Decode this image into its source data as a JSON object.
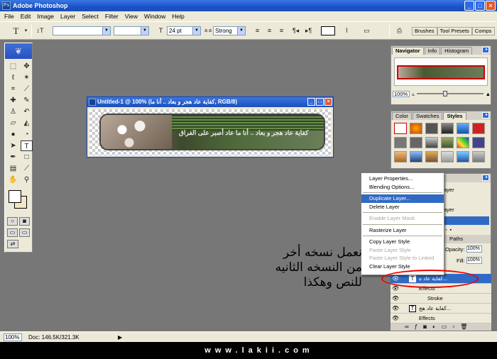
{
  "window": {
    "title": "Adobe Photoshop",
    "min": "_",
    "max": "□",
    "close": "×"
  },
  "menu": [
    "File",
    "Edit",
    "Image",
    "Layer",
    "Select",
    "Filter",
    "View",
    "Window",
    "Help"
  ],
  "options": {
    "font_size": "24 pt",
    "aa_label": "a a",
    "antialias": "Strong",
    "tabs": [
      "Brushes",
      "Tool Presets",
      "Comps"
    ]
  },
  "document": {
    "title": "Untitled-1 @ 100% (كفاية عاد هجر و بعاد .. أنا ما, RGB/8)",
    "banner_text": "كفاية عاد هجر و بعاد .. أنا ما عاد أصبر على الفراق"
  },
  "navigator": {
    "tabs": [
      "Navigator",
      "Info",
      "Histogram"
    ],
    "zoom": "100%"
  },
  "styles": {
    "tabs": [
      "Color",
      "Swatches",
      "Styles"
    ]
  },
  "layers": {
    "tabs": [
      "Paths"
    ],
    "opacity_label": "Opacity:",
    "opacity": "100%",
    "fill_label": "Fill:",
    "fill": "100%",
    "peek_1": "ayer",
    "peek_2": "ayer",
    "rows": [
      {
        "name": "كفاية عاد ه...",
        "selected": true
      },
      {
        "name": "Effects",
        "selected": false
      },
      {
        "name": "Stroke",
        "selected": false
      },
      {
        "name": "كفاية عاد هج...",
        "selected": false
      },
      {
        "name": "Effects",
        "selected": false
      }
    ]
  },
  "context_menu": {
    "items": [
      {
        "label": "Layer Properties...",
        "state": "normal"
      },
      {
        "label": "Blending Options...",
        "state": "normal"
      },
      {
        "sep": true
      },
      {
        "label": "Duplicate Layer...",
        "state": "highlighted"
      },
      {
        "label": "Delete Layer",
        "state": "normal"
      },
      {
        "sep": true
      },
      {
        "label": "Enable Layer Mask",
        "state": "disabled"
      },
      {
        "sep": true
      },
      {
        "label": "Rasterize Layer",
        "state": "normal"
      },
      {
        "sep": true
      },
      {
        "label": "Copy Layer Style",
        "state": "normal"
      },
      {
        "label": "Paste Layer Style",
        "state": "disabled"
      },
      {
        "label": "Paste Layer Style to Linked",
        "state": "disabled"
      },
      {
        "label": "Clear Layer Style",
        "state": "normal"
      }
    ]
  },
  "annotation": {
    "line1": "نعمل نسخه أخر",
    "line2": "من النسخه الثانيه",
    "line3": "للنص وهكذا"
  },
  "status": {
    "zoom": "100%",
    "doc": "Doc: 146.5K/321.3K",
    "arrow": "▶"
  },
  "footer": "www.lakii.com",
  "colors": {
    "highlight": "#316ac5",
    "titlebar": "#1a52c8",
    "ellipse": "#e00000"
  }
}
